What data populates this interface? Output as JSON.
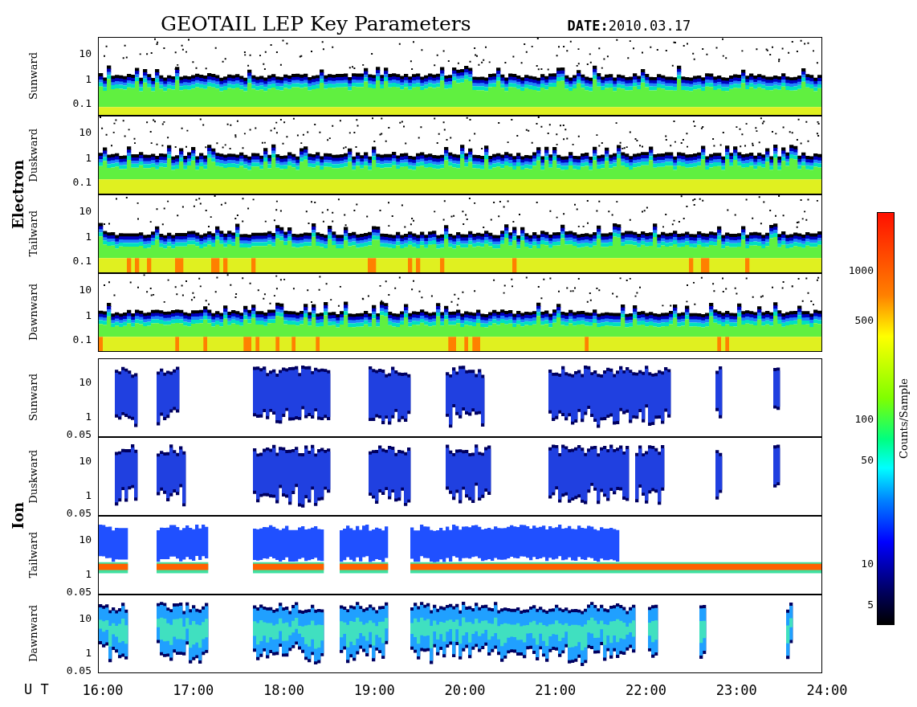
{
  "title": "GEOTAIL LEP Key Parameters",
  "date": "**DATE:**2010.03.17",
  "groups": [
    {
      "kind": "electron",
      "label": "Electron",
      "panels": [
        {
          "label": "Sunward",
          "yticks": [
            "10",
            "1",
            "0.1"
          ]
        },
        {
          "label": "Duskward",
          "yticks": [
            "10",
            "1",
            "0.1"
          ]
        },
        {
          "label": "Tailward",
          "yticks": [
            "10",
            "1",
            "0.1"
          ]
        },
        {
          "label": "Dawnward",
          "yticks": [
            "10",
            "1",
            "0.1"
          ]
        }
      ]
    },
    {
      "kind": "ion",
      "label": "Ion",
      "panels": [
        {
          "label": "Sunward",
          "yticks": [
            "10",
            "1",
            "0.05"
          ]
        },
        {
          "label": "Duskward",
          "yticks": [
            "10",
            "1",
            "0.05"
          ]
        },
        {
          "label": "Tailward",
          "yticks": [
            "10",
            "1",
            "0.05"
          ]
        },
        {
          "label": "Dawnward",
          "yticks": [
            "10",
            "1",
            "0.05"
          ]
        }
      ]
    }
  ],
  "time_axis": {
    "label": "U T",
    "ticks": [
      "16:00",
      "17:00",
      "18:00",
      "19:00",
      "20:00",
      "21:00",
      "22:00",
      "23:00",
      "24:00"
    ]
  },
  "colorbar": {
    "title": "Counts/Sample",
    "ticks": [
      "1000",
      "500",
      "100",
      "50",
      "10",
      "5"
    ]
  }
}
